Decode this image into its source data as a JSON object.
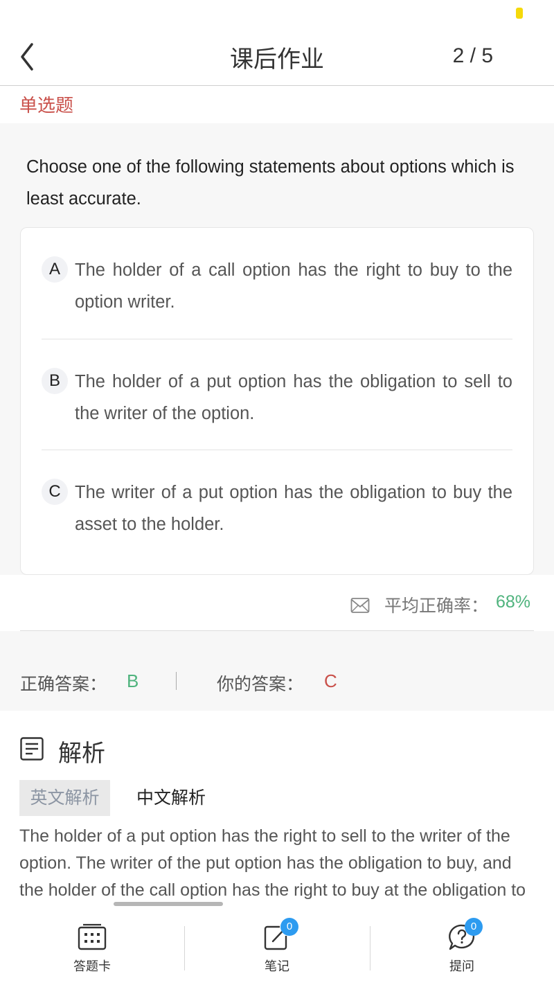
{
  "header": {
    "title": "课后作业",
    "progress": "2 / 5"
  },
  "question": {
    "type_label": "单选题",
    "text": "Choose one of the following statements about options which is least accurate.",
    "options": [
      {
        "letter": "A",
        "text": "The holder of a call option has the right to buy to the option writer."
      },
      {
        "letter": "B",
        "text": "The holder of a put option has the obligation to sell to the writer of the option."
      },
      {
        "letter": "C",
        "text": "The writer of a put option has the obligation to buy the asset to the holder."
      }
    ]
  },
  "stats": {
    "avg_label": "平均正确率：",
    "avg_value": "68%"
  },
  "answers": {
    "correct_label": "正确答案：",
    "correct_value": "B",
    "separator": "|",
    "yours_label": "你的答案：",
    "yours_value": "C"
  },
  "analysis": {
    "title": "解析",
    "tab_english": "英文解析",
    "tab_chinese": "中文解析",
    "text": "The holder of a put option has the right to sell to the writer of the option. The writer of the put option has the obligation to buy, and the holder of the call option has the right to buy at the obligation to take."
  },
  "bottom_bar": {
    "answer_card_label": "答题卡",
    "notes_label": "笔记",
    "notes_badge": "0",
    "ask_label": "提问",
    "ask_badge": "0"
  },
  "colors": {
    "accent_red": "#c9504a",
    "accent_green": "#4fb37d",
    "badge_blue": "#2d9bf0",
    "status_yellow": "#f5d90a"
  }
}
